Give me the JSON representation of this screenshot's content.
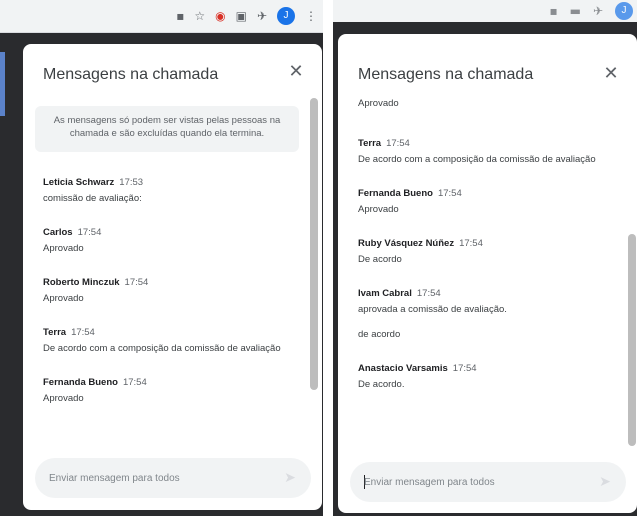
{
  "panel_title": "Mensagens na chamada",
  "close_icon": "close-icon",
  "info_notice": "As mensagens só podem ser vistas pelas pessoas na chamada e são excluídas quando ela termina.",
  "composer_placeholder": "Enviar mensagem para todos",
  "toolbar_icons": [
    "grid-icon",
    "star-icon",
    "extension-icon",
    "monitor-icon",
    "pin-icon",
    "profile-avatar"
  ],
  "avatar_letter": "J",
  "left_messages": [
    {
      "sender": "Leticia Schwarz",
      "time": "17:53",
      "lines": [
        "comissão de avaliação:"
      ]
    },
    {
      "sender": "Carlos",
      "time": "17:54",
      "lines": [
        "Aprovado"
      ]
    },
    {
      "sender": "Roberto Minczuk",
      "time": "17:54",
      "lines": [
        "Aprovado"
      ]
    },
    {
      "sender": "Terra",
      "time": "17:54",
      "lines": [
        "De acordo com a composição da comissão de avaliação"
      ]
    },
    {
      "sender": "Fernanda Bueno",
      "time": "17:54",
      "lines": [
        "Aprovado"
      ]
    }
  ],
  "right_partial_text": "Aprovado",
  "right_messages": [
    {
      "sender": "Terra",
      "time": "17:54",
      "lines": [
        "De acordo com a composição da comissão de avaliação"
      ]
    },
    {
      "sender": "Fernanda Bueno",
      "time": "17:54",
      "lines": [
        "Aprovado"
      ]
    },
    {
      "sender": "Ruby Vásquez Núñez",
      "time": "17:54",
      "lines": [
        "De acordo"
      ]
    },
    {
      "sender": "Ivam Cabral",
      "time": "17:54",
      "lines": [
        "aprovada a comissão de avaliação.",
        "de acordo"
      ]
    },
    {
      "sender": "Anastacio Varsamis",
      "time": "17:54",
      "lines": [
        "De acordo."
      ]
    }
  ],
  "colors": {
    "page_dark": "#2a2b2e",
    "card": "#ffffff",
    "muted_bg": "#f1f3f4",
    "scrollbar": "#bdbdbd",
    "avatar_blue": "#1a73e8"
  }
}
